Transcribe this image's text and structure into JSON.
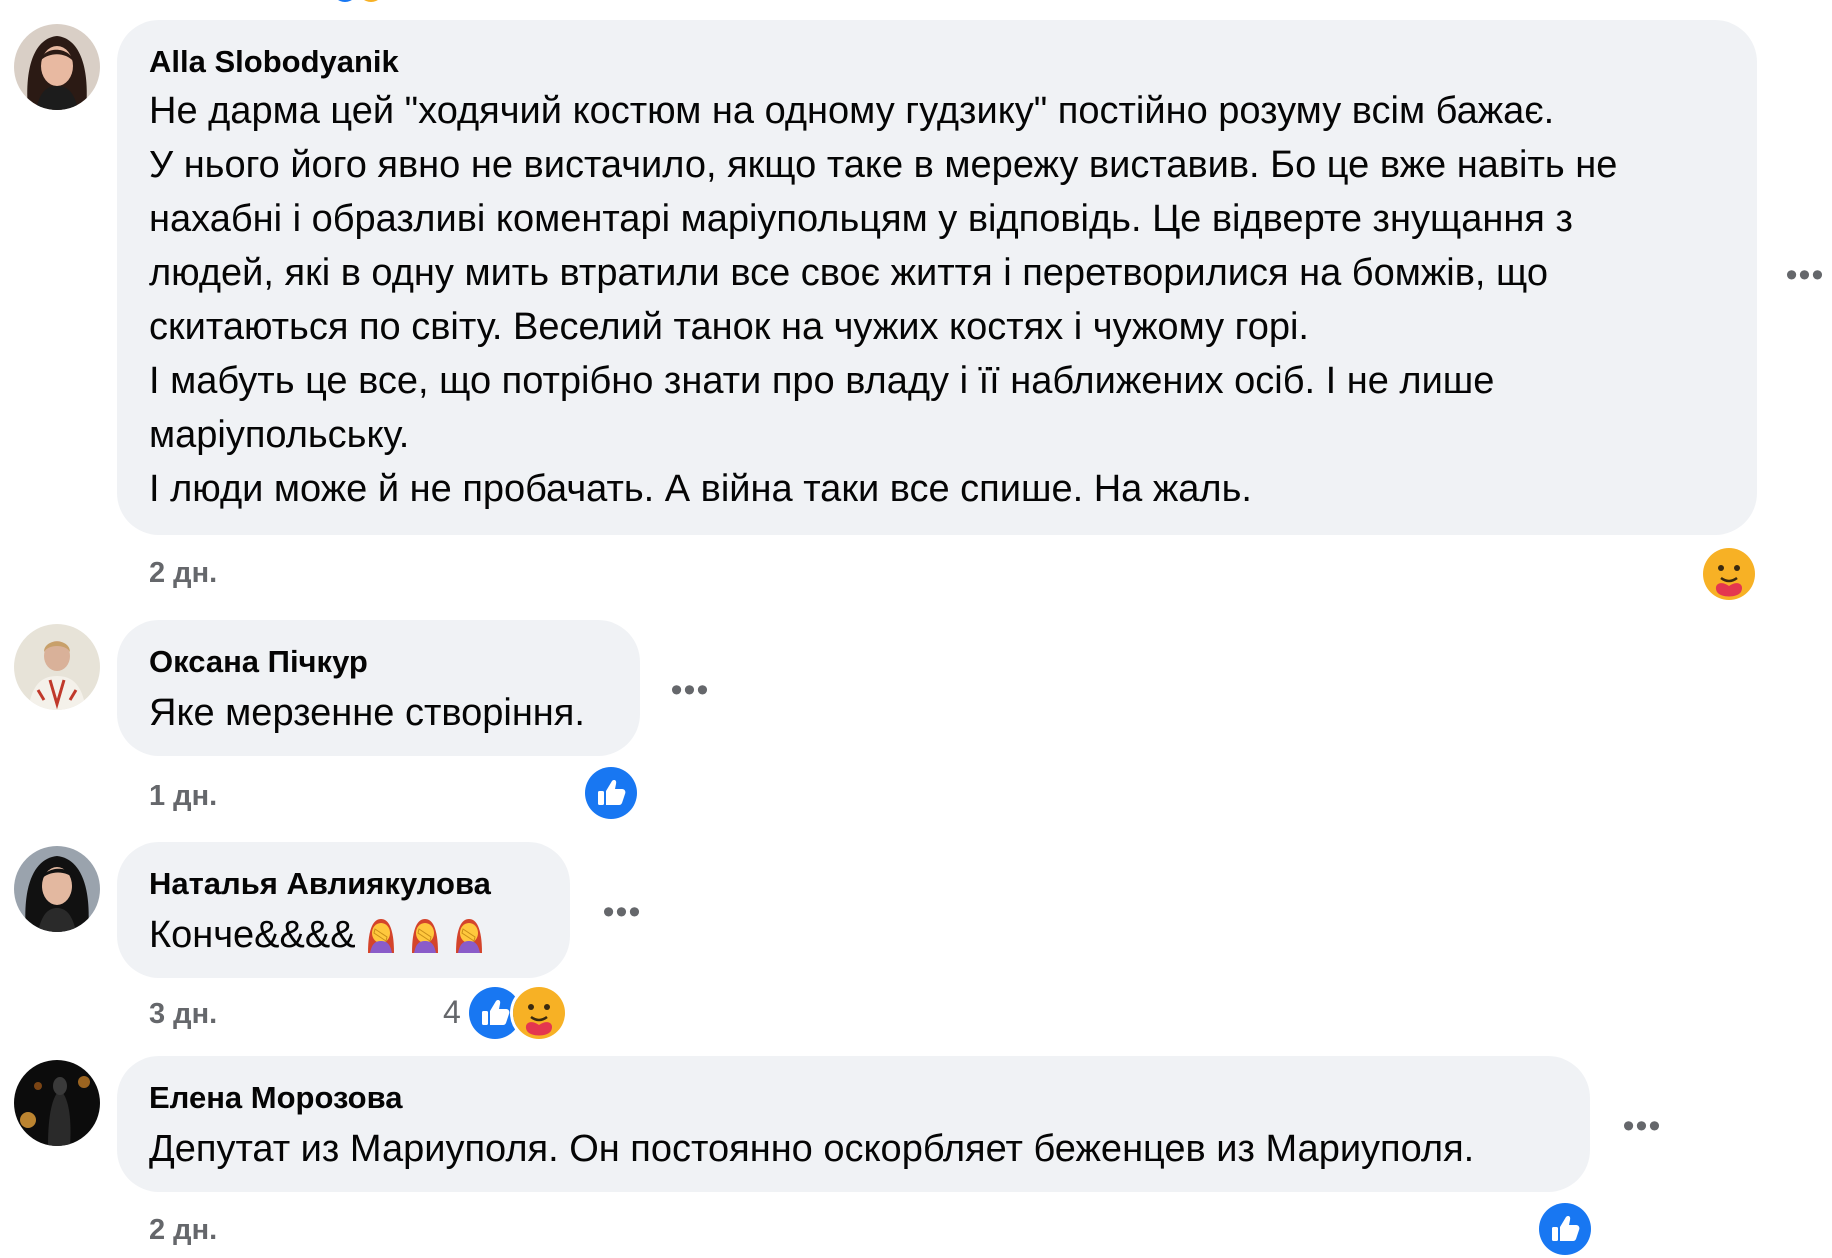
{
  "comments": [
    {
      "author": "Alla Slobodyanik",
      "lines": [
        "Не дарма цей \"ходячий костюм на одному гудзику\" постійно розуму всім бажає.",
        "У нього його явно не вистачило, якщо таке в мережу виставив. Бо це вже навіть не",
        "нахабні і образливі коментарі маріупольцям у відповідь. Це відверте знущання з",
        "людей, які в одну мить втратили все своє життя і перетворилися на бомжів, що",
        "скитаються по світу. Веселий танок на чужих костях і чужому горі.",
        "І мабуть це все, що потрібно знати про владу і її наближених осіб. І не лише",
        "маріупольську.",
        "І люди може й не пробачать. А війна таки все спише. На жаль."
      ],
      "time": "2 дн.",
      "reactions": [
        "care-icon"
      ]
    },
    {
      "author": "Оксана Пічкур",
      "lines": [
        "Яке мерзенне створіння."
      ],
      "time": "1 дн.",
      "reactions": [
        "like-icon"
      ]
    },
    {
      "author": "Наталья Авлиякулова",
      "lines": [
        "Конче&&&&"
      ],
      "emoji": [
        "woman-facepalming",
        "woman-facepalming",
        "woman-facepalming"
      ],
      "time": "3 дн.",
      "reaction_count": "4",
      "reactions": [
        "like-icon",
        "care-icon"
      ]
    },
    {
      "author": "Елена Морозова",
      "lines": [
        "Депутат из Мариуполя. Он постоянно оскорбляет беженцев из Мариуполя."
      ],
      "time": "2 дн.",
      "reactions": [
        "like-icon"
      ]
    }
  ],
  "more_label": "•••",
  "colors": {
    "bubble": "#f0f2f5",
    "like_blue": "#1877f2",
    "secondary_text": "#65676b",
    "care_yellow": "#f7b125"
  }
}
